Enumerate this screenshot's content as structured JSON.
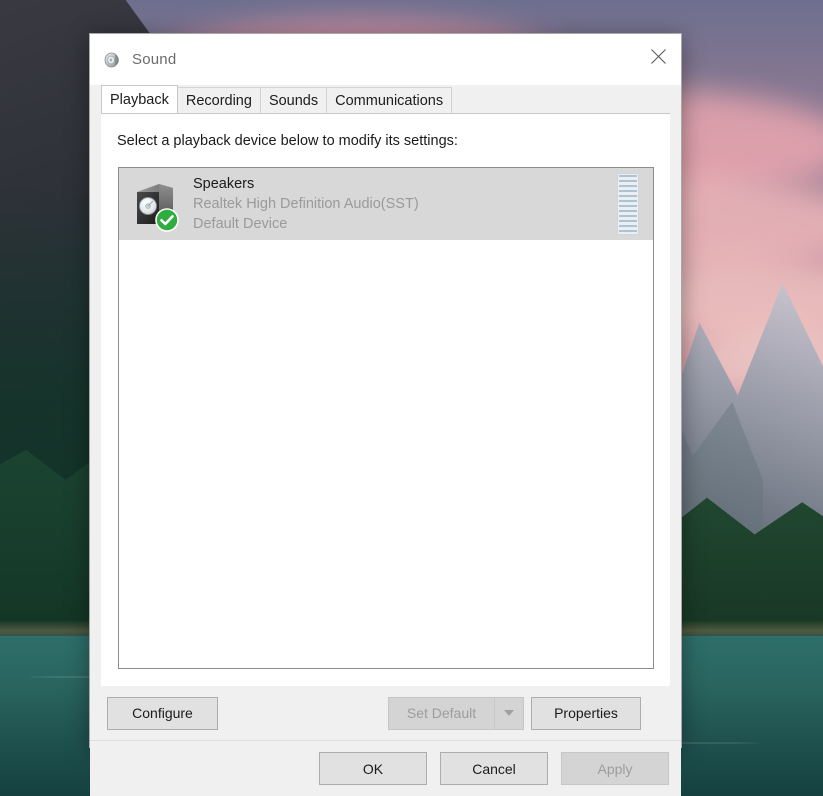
{
  "window": {
    "title": "Sound",
    "title_icon": "speaker-icon",
    "close_icon": "close-icon"
  },
  "tabs": [
    {
      "label": "Playback",
      "active": true
    },
    {
      "label": "Recording",
      "active": false
    },
    {
      "label": "Sounds",
      "active": false
    },
    {
      "label": "Communications",
      "active": false
    }
  ],
  "content": {
    "instruction": "Select a playback device below to modify its settings:",
    "devices": [
      {
        "name": "Speakers",
        "driver": "Realtek High Definition Audio(SST)",
        "status": "Default Device",
        "icon": "speaker-device-icon",
        "badge": "green-check-badge",
        "selected": true,
        "meter_segments": 12,
        "meter_level": 0
      }
    ]
  },
  "buttons": {
    "configure": {
      "label": "Configure",
      "enabled": true
    },
    "set_default": {
      "label": "Set Default",
      "enabled": false,
      "dropdown_icon": "chevron-down-icon"
    },
    "properties": {
      "label": "Properties",
      "enabled": true
    }
  },
  "footer": {
    "ok": {
      "label": "OK",
      "enabled": true
    },
    "cancel": {
      "label": "Cancel",
      "enabled": true
    },
    "apply": {
      "label": "Apply",
      "enabled": false
    }
  },
  "colors": {
    "accent_green": "#2fad3f",
    "window_bg": "#f0f0f0",
    "panel_bg": "#ffffff",
    "selection_bg": "#d8d8d8",
    "disabled_text": "#9d9d9d"
  }
}
